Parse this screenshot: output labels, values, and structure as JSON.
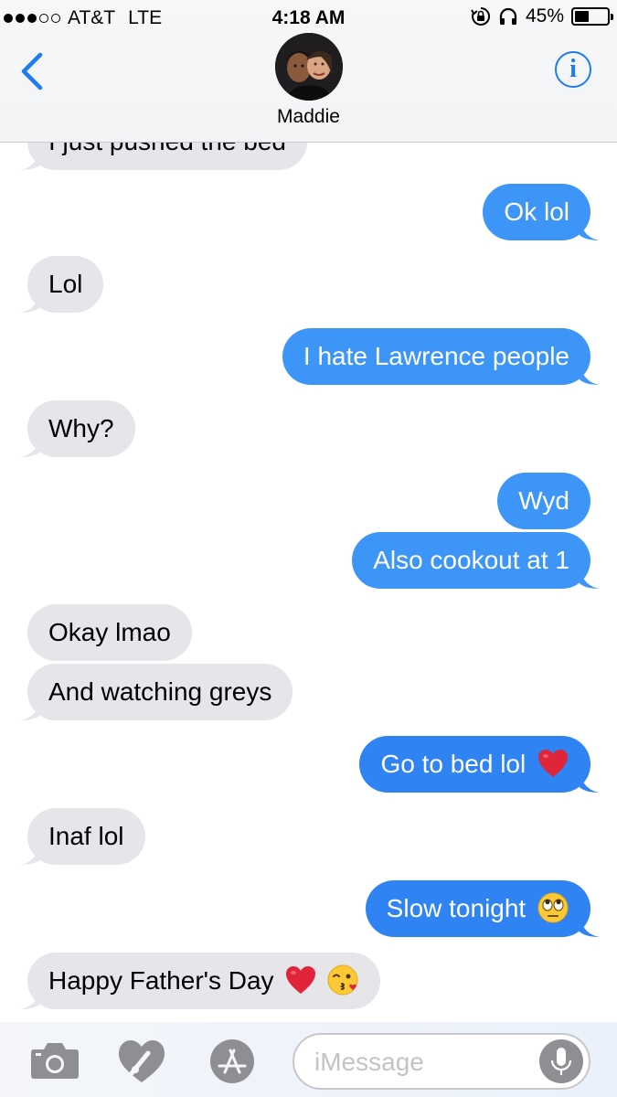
{
  "status_bar": {
    "carrier": "AT&T",
    "network": "LTE",
    "time": "4:18 AM",
    "battery_percent": "45%",
    "battery_level": 0.45,
    "icons": [
      "signal-dots-icon",
      "orientation-lock-icon",
      "headphones-icon",
      "battery-icon"
    ]
  },
  "header": {
    "contact_name": "Maddie",
    "back_icon": "chevron-left-icon",
    "info_icon": "info-icon",
    "info_glyph": "i"
  },
  "messages": [
    {
      "direction": "in",
      "text": "I just pushed the bed"
    },
    {
      "direction": "out",
      "text": "Ok lol"
    },
    {
      "direction": "in",
      "text": "Lol"
    },
    {
      "direction": "out",
      "text": "I hate Lawrence people"
    },
    {
      "direction": "in",
      "text": "Why?"
    },
    {
      "direction": "out",
      "text": "Wyd"
    },
    {
      "direction": "out",
      "text": "Also cookout at 1"
    },
    {
      "direction": "in",
      "text": "Okay lmao"
    },
    {
      "direction": "in",
      "text": "And watching greys"
    },
    {
      "direction": "out",
      "text": "Go to bed lol",
      "emoji": [
        "red-heart-emoji"
      ]
    },
    {
      "direction": "in",
      "text": "Inaf lol"
    },
    {
      "direction": "out",
      "text": "Slow tonight",
      "emoji": [
        "eye-roll-emoji"
      ]
    },
    {
      "direction": "in",
      "text": "Happy Father's Day",
      "emoji": [
        "red-heart-emoji",
        "kissing-face-emoji"
      ]
    }
  ],
  "input_bar": {
    "placeholder": "iMessage",
    "icons": [
      "camera-icon",
      "digital-touch-icon",
      "app-store-icon",
      "microphone-icon"
    ]
  },
  "colors": {
    "incoming_bubble": "#e5e5ea",
    "outgoing_bubble": "#3d96f7",
    "accent": "#1e7cf2"
  }
}
